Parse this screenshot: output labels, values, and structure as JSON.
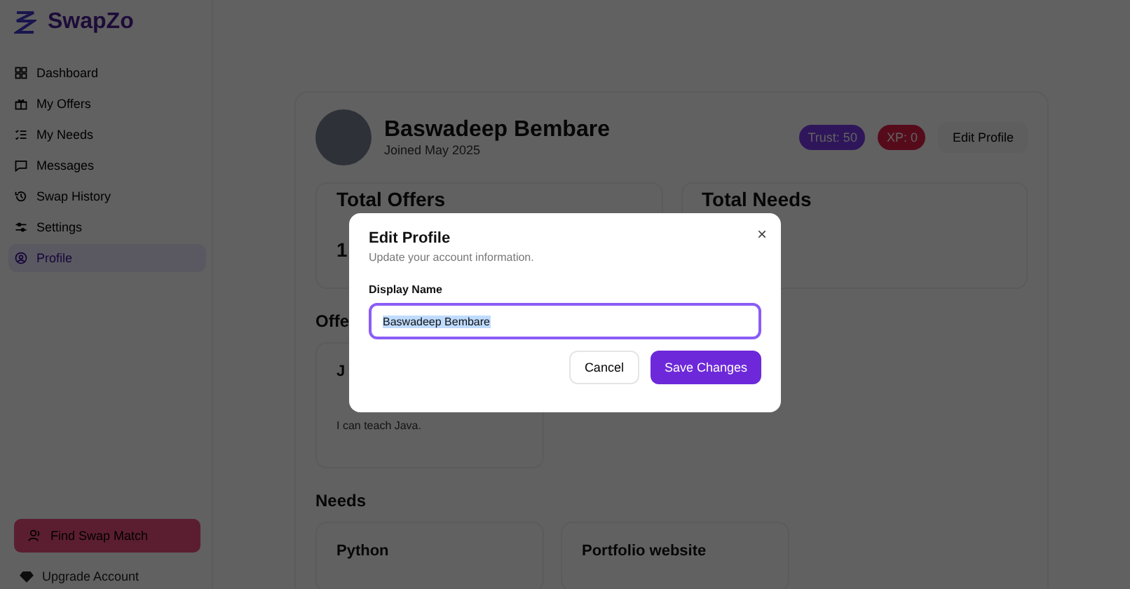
{
  "sidebar": {
    "logo": "SwapZo",
    "items": [
      {
        "label": "Dashboard",
        "selected": false
      },
      {
        "label": "My Offers",
        "selected": false
      },
      {
        "label": "My Needs",
        "selected": false
      },
      {
        "label": "Messages",
        "selected": false
      },
      {
        "label": "Swap History",
        "selected": false
      },
      {
        "label": "Settings",
        "selected": false
      },
      {
        "label": "Profile",
        "selected": true
      }
    ],
    "primary_button": "Find Swap Match",
    "upgrade": "Upgrade Account"
  },
  "profile": {
    "name": "Baswadeep Bembare",
    "joined": "Joined May 2025",
    "badges": [
      "Trust: 50",
      "XP: 0"
    ],
    "edit_button": "Edit Profile"
  },
  "stats": [
    {
      "label": "Total Offers",
      "value": "1"
    },
    {
      "label": "Total Needs"
    }
  ],
  "offers": {
    "heading": "Offe",
    "cards": [
      {
        "title": "J",
        "description": "I can teach Java."
      }
    ]
  },
  "needs": {
    "heading": "Needs",
    "cards": [
      {
        "title": "Python"
      },
      {
        "title": "Portfolio website"
      }
    ]
  },
  "dialog": {
    "title": "Edit Profile",
    "subtitle": "Update your account information.",
    "field_label": "Display Name",
    "value": "Baswadeep Bembare",
    "value_selected": true,
    "cancel": "Cancel",
    "save": "Save Changes",
    "close": "×"
  }
}
